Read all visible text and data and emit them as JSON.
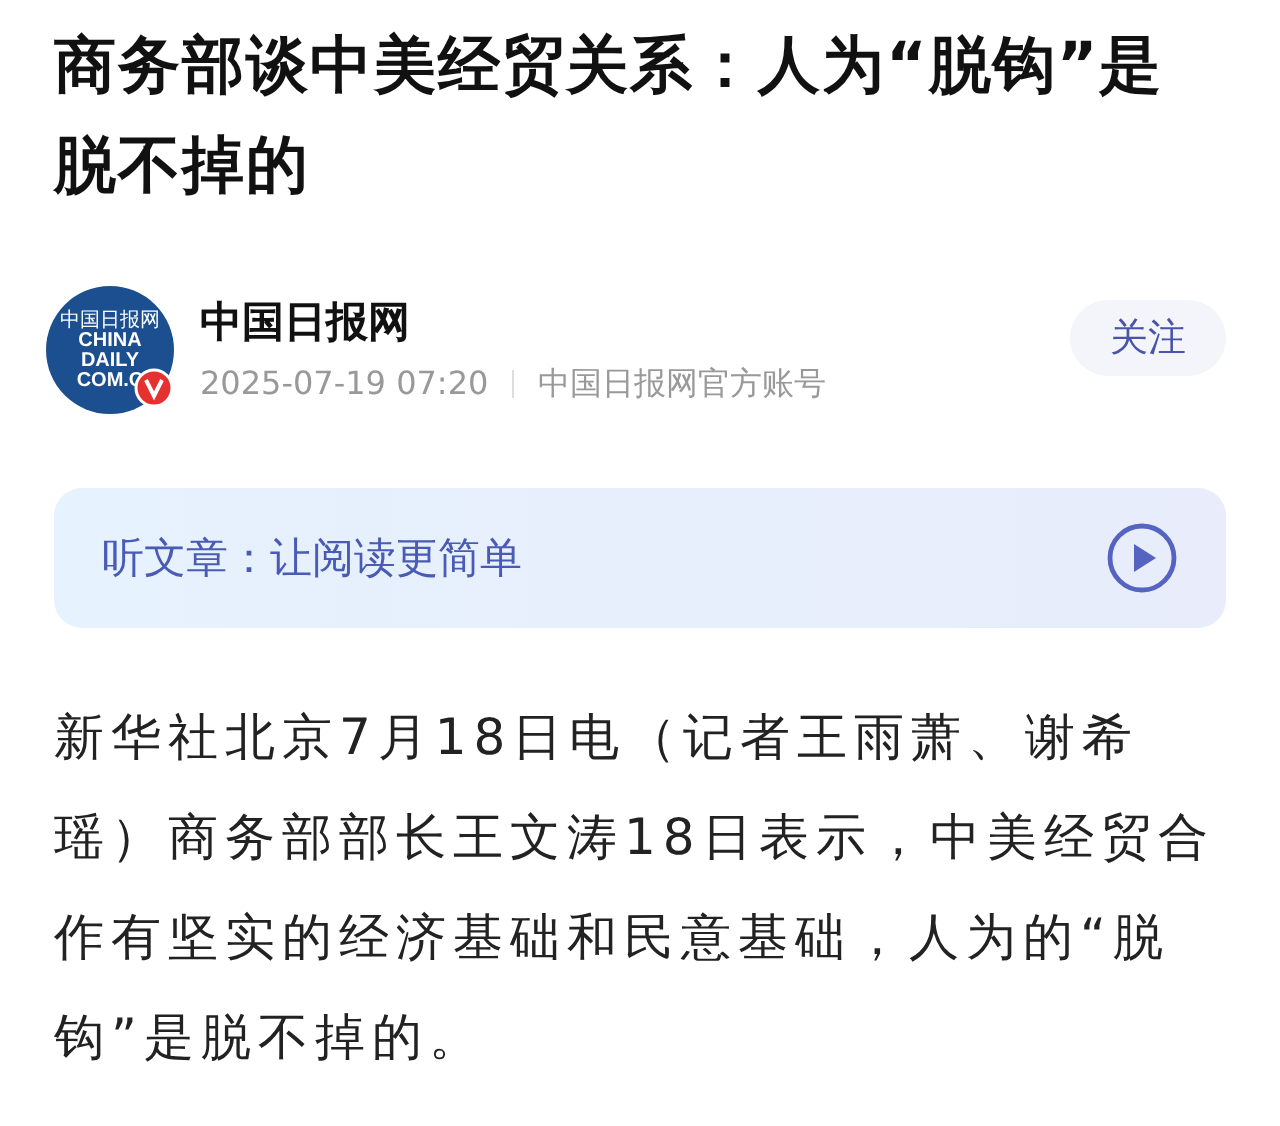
{
  "headline": "商务部谈中美经贸关系：人为“脱钩”是脱不掉的",
  "author": {
    "logo_lines": [
      "中国日报网",
      "CHINA",
      "DAILY",
      "COM.C"
    ],
    "verified": true,
    "name": "中国日报网",
    "time": "2025-07-19 07:20",
    "account": "中国日报网官方账号",
    "follow_button": "关注"
  },
  "listen_banner": {
    "label": "听文章：让阅读更简单"
  },
  "body": "新华社北京7月18日电（记者王雨萧、谢希瑶）商务部部长王文涛18日表示，中美经贸合作有坚实的经济基础和民意基础，人为的“脱钩”是脱不掉的。"
}
